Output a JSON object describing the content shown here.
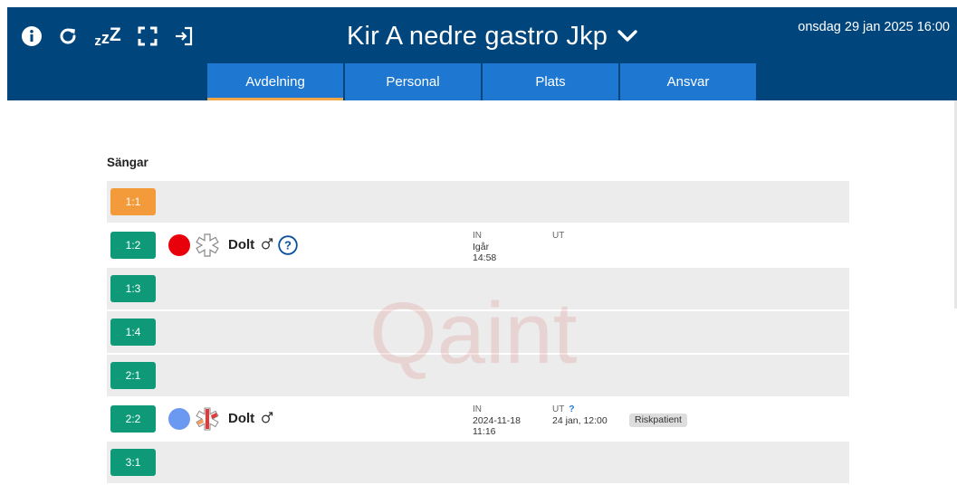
{
  "header": {
    "title": "Kir A nedre gastro Jkp",
    "datetime": "onsdag 29 jan 2025 16:00",
    "sleep_icon_text": [
      "z",
      "z",
      "Z"
    ],
    "background_color": "#00457c"
  },
  "tabs": [
    {
      "label": "Avdelning",
      "active": true
    },
    {
      "label": "Personal",
      "active": false
    },
    {
      "label": "Plats",
      "active": false
    },
    {
      "label": "Ansvar",
      "active": false
    }
  ],
  "colors": {
    "tab": "#1e78d2",
    "tab_active_underline": "#f2a64a",
    "bed_green": "#0e9a78",
    "bed_orange": "#f39a3b",
    "dot_red": "#e8000b",
    "dot_blue": "#6b98f0"
  },
  "section_title": "Sängar",
  "watermark": "Qaint",
  "beds": [
    {
      "id": "1:1",
      "color": "orange"
    },
    {
      "id": "1:2",
      "color": "green",
      "patient": {
        "status_dot": "red",
        "ems_icon": "star-of-life-outline-icon",
        "name": "Dolt",
        "gender": "male",
        "help": "?",
        "in_label": "IN",
        "in_line1": "Igår",
        "in_line2": "14:58",
        "ut_label": "UT"
      }
    },
    {
      "id": "1:3",
      "color": "green"
    },
    {
      "id": "1:4",
      "color": "green"
    },
    {
      "id": "2:1",
      "color": "green"
    },
    {
      "id": "2:2",
      "color": "green",
      "patient": {
        "status_dot": "blue",
        "ems_icon": "star-of-life-red-icon",
        "name": "Dolt",
        "gender": "male",
        "in_label": "IN",
        "in_line1": "2024-11-18",
        "in_line2": "11:16",
        "ut_label": "UT",
        "ut_q": "?",
        "ut_line1": "24 jan, 12:00",
        "risk": "Riskpatient"
      }
    },
    {
      "id": "3:1",
      "color": "green"
    }
  ]
}
